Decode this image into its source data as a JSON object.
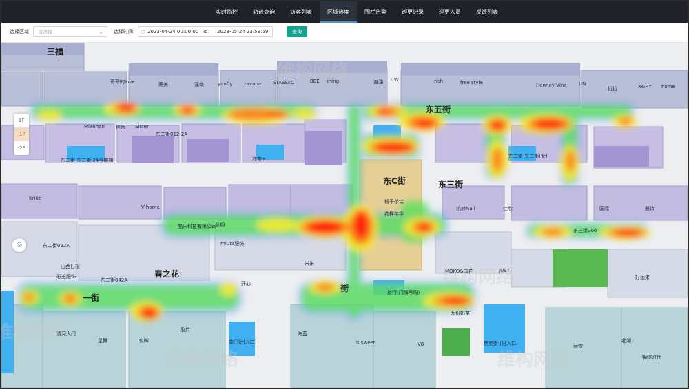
{
  "nav": {
    "items": [
      "实时监控",
      "轨迹查询",
      "访客列表",
      "区域热度",
      "围栏告警",
      "巡更记录",
      "巡更人员",
      "反馈列表"
    ],
    "active_index": 3
  },
  "filter": {
    "region_label": "选择区域",
    "region_placeholder": "请选择",
    "time_label": "选择时间:",
    "start": "2023-04-24 00:00:00",
    "to_label": "To",
    "end": "2023-05-24 23:59:59",
    "query_label": "查询"
  },
  "floors": [
    "1F",
    "-1F",
    "-2F"
  ],
  "active_floor": "-1F",
  "compass_icon": "locate-icon",
  "watermark": "维构网络",
  "map_labels": {
    "sanfu": "三福",
    "dongwu": "东五街",
    "dongc": "东C街",
    "dongsan": "东三街",
    "chunzhihua": "春之花",
    "jie1": "一街",
    "jie2": "街",
    "shop_hot_love": "哥哥的love",
    "shop_tongnan": "潼南",
    "shop_shoumei": "寿美",
    "shop_yanfly": "yanfly",
    "shop_zavana": "zavana",
    "shop_stassko": "STASSKO",
    "shop_bee": "BEE",
    "shop_thing": "thing",
    "shop_gucheng": "吉油",
    "shop_cw": "CW",
    "shop_free": "free style",
    "shop_rich": "rich",
    "shop_henney": "Henney Vlna",
    "shop_un": "UN",
    "shop_ddb": "拉拉",
    "shop_xchy": "X&HY",
    "shop_kriliz": "Kriliz",
    "shop_home": "home",
    "shop_mianhan": "Mianhan",
    "shop_jiahe": "佳禾",
    "shop_sister": "Sister",
    "shop_dongc012a": "东二街012-2A",
    "shop_dongtong": "东二街 东二街 24号楼梯",
    "shop_vhome": "V-home",
    "shop_nail": "抗赫Nail",
    "shop_miuta": "miuta服饰",
    "shop_kaile": "酷乐科技有限公司",
    "shop_moko": "MOKO&国花",
    "shop_just": "JUST",
    "shop_lssweet": "ls sweet",
    "shop_v8": "V8",
    "shop_longxiang": "龙翔",
    "shop_liangcha": "凉茶+",
    "shop_dongjie": "东二街 东二街(女)",
    "shop_juzi": "橘子茶饮",
    "shop_shop2": "花样年华",
    "shop_lvxing": "旅行(门牌号码)",
    "shop_dongsan006": "东三街006",
    "shop_jiuhen": "九份奶茶",
    "shop_fangmai": "房卖街 (出入口)",
    "shop_guoji": "国际",
    "shop_nanmen": "南门(出入口)",
    "shop_dongjia": "东二街042A",
    "shop_dongjib": "东二街022A",
    "shop_shanxi": "山西日报",
    "shop_caizhi": "彩芝服饰",
    "shop_lixue": "丽雪",
    "shop_beihu": "北湖",
    "shop_qinghe": "清河大门",
    "shop_xingwu": "星舞",
    "shop_yimo": "仪眸",
    "shop_jiaopian": "胶片",
    "shop_hailan": "海蓝",
    "shop_kaixin": "开心",
    "shop_mimi": "米米",
    "shop_jinxiu": "锦绣时代",
    "shop_haoyun": "好运来",
    "shop_jiaxin": "佳欣",
    "shop_yashi": "雅诗"
  }
}
